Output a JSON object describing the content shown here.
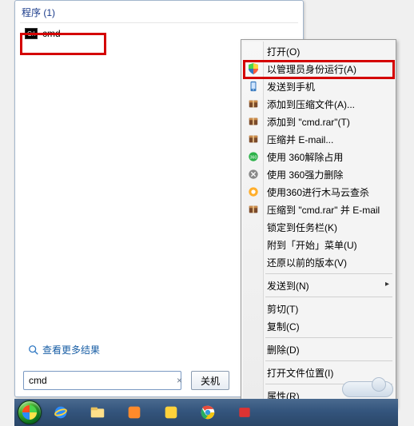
{
  "start": {
    "programs_header": "程序 (1)",
    "program_label": "cmd",
    "more_results": "查看更多结果",
    "search_value": "cmd",
    "shutdown_label": "关机"
  },
  "context_menu": {
    "open": "打开(O)",
    "run_as_admin": "以管理员身份运行(A)",
    "send_to_phone": "发送到手机",
    "add_to_archive": "添加到压缩文件(A)...",
    "add_to_cmd_rar": "添加到 \"cmd.rar\"(T)",
    "compress_email": "压缩并 E-mail...",
    "use_360_unlock": "使用 360解除占用",
    "use_360_force_delete": "使用 360强力删除",
    "use_360_trojan": "使用360进行木马云查杀",
    "compress_cmd_email": "压缩到 \"cmd.rar\" 并 E-mail",
    "pin_taskbar": "锁定到任务栏(K)",
    "pin_start": "附到「开始」菜单(U)",
    "restore_versions": "还原以前的版本(V)",
    "send_to": "发送到(N)",
    "cut": "剪切(T)",
    "copy": "复制(C)",
    "delete": "删除(D)",
    "open_location": "打开文件位置(I)",
    "properties": "属性(R)"
  }
}
